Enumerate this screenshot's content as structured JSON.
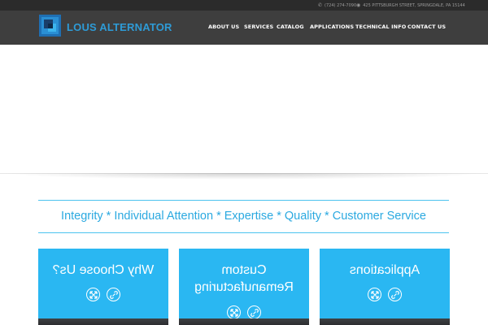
{
  "topbar": {
    "phone": "(724) 274-7090",
    "address": "425 PITTSBURGH STREET, SPRINGDALE, PA 15144",
    "phone_icon": "phone-icon",
    "address_icon": "map-pin-icon"
  },
  "brand": {
    "name": "LOUS ALTERNATOR",
    "color": "#2e9bd6"
  },
  "nav": {
    "items": [
      {
        "label": "ABOUT US"
      },
      {
        "label": "SERVICES"
      },
      {
        "label": "CATALOG"
      },
      {
        "label": "APPLICATIONS"
      },
      {
        "label": "TECHNICAL INFO"
      },
      {
        "label": "CONTACT US"
      }
    ]
  },
  "tagline": "Integrity * Individual Attention * Expertise * Quality * Customer Service",
  "cards": [
    {
      "title_lines": [
        "Why Choose Us?"
      ],
      "expand_icon": "expand-icon",
      "link_icon": "link-icon"
    },
    {
      "title_lines": [
        "Custom",
        "Remanufacturing"
      ],
      "expand_icon": "expand-icon",
      "link_icon": "link-icon"
    },
    {
      "title_lines": [
        "Applications"
      ],
      "expand_icon": "expand-icon",
      "link_icon": "link-icon"
    }
  ],
  "colors": {
    "header_bg": "#3e3e3e",
    "topbar_bg": "#2b2b2b",
    "accent": "#2ab7f2",
    "tagline_text": "#2ba9e0"
  }
}
